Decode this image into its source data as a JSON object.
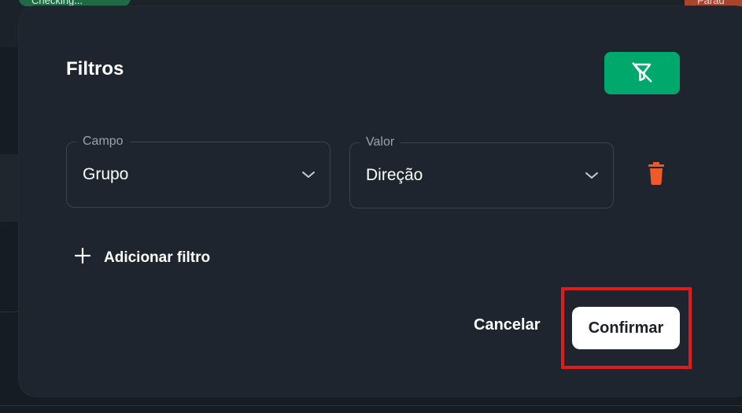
{
  "background": {
    "tag_left": "Checking...",
    "tag_right": "Parad"
  },
  "modal": {
    "title": "Filtros",
    "clear_filters_icon": "filter-off-icon",
    "filters": [
      {
        "field_label": "Campo",
        "field_value": "Grupo",
        "value_label": "Valor",
        "value_value": "Direção"
      }
    ],
    "add_filter_label": "Adicionar filtro",
    "cancel_label": "Cancelar",
    "confirm_label": "Confirmar"
  },
  "colors": {
    "accent_green": "#00a86b",
    "danger": "#f05a28",
    "highlight": "#e01b1b",
    "modal_bg": "#1f252e"
  }
}
